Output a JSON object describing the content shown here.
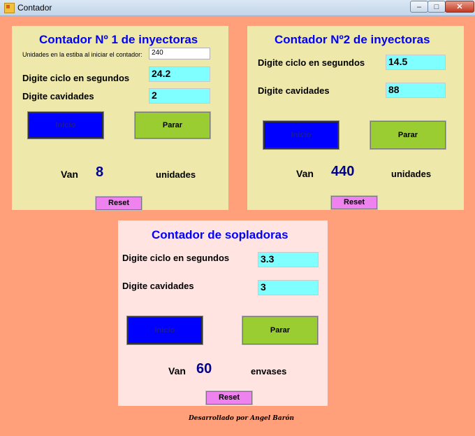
{
  "window": {
    "title": "Contador",
    "min_symbol": "–",
    "max_symbol": "□",
    "close_symbol": "✕"
  },
  "panel1": {
    "title": "Contador Nº 1 de inyectoras",
    "units_label": "Unidades en la estiba al iniciar el contador:",
    "units_value": "240",
    "cycle_label": "Digite ciclo en segundos",
    "cycle_value": "24.2",
    "cavities_label": "Digite  cavidades",
    "cavities_value": "2",
    "start_label": "Inicio",
    "stop_label": "Parar",
    "van_label": "Van",
    "count": "8",
    "unit_label": "unidades",
    "reset_label": "Reset"
  },
  "panel2": {
    "title": "Contador Nº2 de inyectoras",
    "cycle_label": "Digite ciclo en segundos",
    "cycle_value": "14.5",
    "cavities_label": "Digite  cavidades",
    "cavities_value": "88",
    "start_label": "Inicio",
    "stop_label": "Parar",
    "van_label": "Van",
    "count": "440",
    "unit_label": "unidades",
    "reset_label": "Reset"
  },
  "panel3": {
    "title": "Contador de sopladoras",
    "cycle_label": "Digite ciclo en segundos",
    "cycle_value": "3.3",
    "cavities_label": "Digite  cavidades",
    "cavities_value": "3",
    "start_label": "Inicio",
    "stop_label": "Parar",
    "van_label": "Van",
    "count": "60",
    "unit_label": "envases",
    "reset_label": "Reset"
  },
  "footer": {
    "credit": "Desarrollado por Angel Barón"
  },
  "colors": {
    "background": "#ffa07a",
    "panel_yellow": "#eee8aa",
    "panel_pink": "#ffe4e1",
    "title_blue": "#0000ff",
    "input_cyan": "#7fffff",
    "start_button": "#0000ff",
    "stop_button": "#9acd32",
    "reset_button": "#ee82ee",
    "count_color": "#00008b"
  }
}
